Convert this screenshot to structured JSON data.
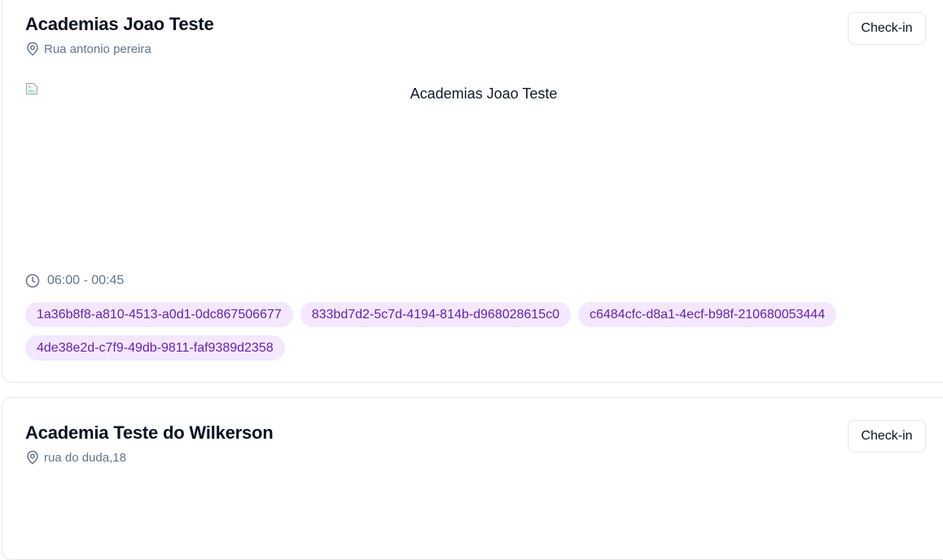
{
  "gyms": [
    {
      "name": "Academias Joao Teste",
      "address": "Rua antonio pereira",
      "checkin_label": "Check-in",
      "image_alt": "Academias Joao Teste",
      "hours": "06:00 - 00:45",
      "tags": [
        "1a36b8f8-a810-4513-a0d1-0dc867506677",
        "833bd7d2-5c7d-4194-814b-d968028615c0",
        "c6484cfc-d8a1-4ecf-b98f-210680053444",
        "4de38e2d-c7f9-49db-9811-faf9389d2358"
      ]
    },
    {
      "name": "Academia Teste do Wilkerson",
      "address": "rua do duda,18",
      "checkin_label": "Check-in"
    }
  ],
  "icons": {
    "location": "map-pin-icon",
    "clock": "clock-icon",
    "broken_image": "broken-image-icon"
  },
  "colors": {
    "tag_background": "#f3e8ff",
    "tag_text": "#6b21a8",
    "muted_text": "#64748b",
    "border": "#e5e7eb"
  }
}
